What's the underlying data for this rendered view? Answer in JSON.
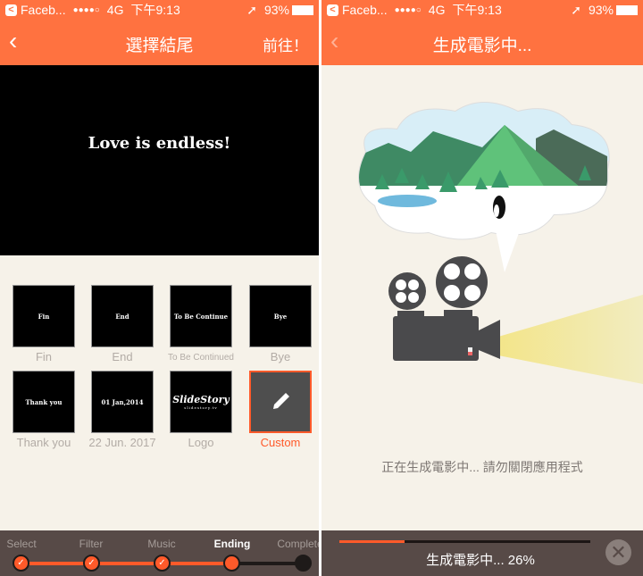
{
  "status": {
    "app": "Faceb...",
    "carrier_dots": "●●●●○",
    "network": "4G",
    "time": "下午9:13",
    "battery": "93%"
  },
  "left": {
    "nav": {
      "back": "‹",
      "title": "選擇結尾",
      "go": "前往！"
    },
    "preview_text": "Love is endless!",
    "endings": [
      {
        "tile": "Fin",
        "label": "Fin"
      },
      {
        "tile": "End",
        "label": "End"
      },
      {
        "tile": "To Be Continue",
        "label": "To Be Continued"
      },
      {
        "tile": "Bye",
        "label": "Bye"
      },
      {
        "tile": "Thank you",
        "label": "Thank you"
      },
      {
        "tile": "01 Jan,2014",
        "label": "22 Jun. 2017"
      },
      {
        "tile": "SlideStory",
        "tile_sub": "slidestory.tv",
        "label": "Logo"
      },
      {
        "tile": "",
        "label": "Custom",
        "selected": true,
        "icon": "pencil-icon"
      }
    ],
    "steps": [
      {
        "label": "Select",
        "done": true
      },
      {
        "label": "Filter",
        "done": true
      },
      {
        "label": "Music",
        "done": true
      },
      {
        "label": "Ending",
        "active": true
      },
      {
        "label": "Complete"
      }
    ]
  },
  "right": {
    "nav": {
      "back": "‹",
      "title": "生成電影中..."
    },
    "message": "正在生成電影中... 請勿關閉應用程式",
    "progress_percent": 26,
    "progress_text": "生成電影中... 26%",
    "close_icon": "close-icon"
  },
  "colors": {
    "accent": "#ff7240",
    "active": "#ff5a2a",
    "bar": "#574a47",
    "bg": "#f6f2e9"
  }
}
